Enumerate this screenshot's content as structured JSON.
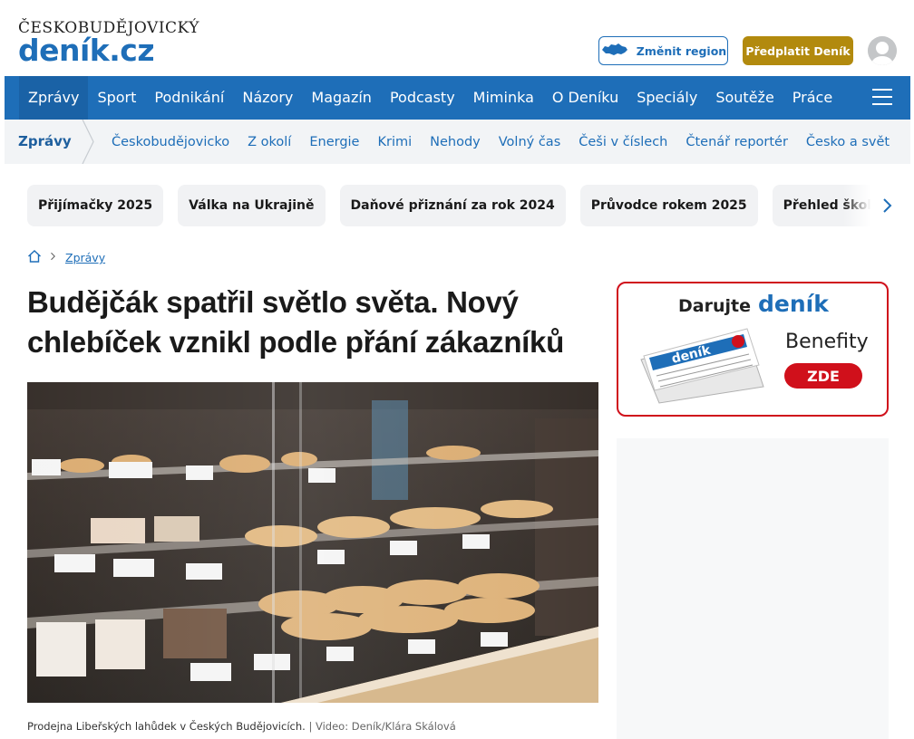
{
  "header": {
    "logo_top": "ČESKOBUDĚJOVICKÝ",
    "logo_main": "deník.cz",
    "change_region_label": "Změnit region",
    "subscribe_label": "Předplatit Deník"
  },
  "main_nav": {
    "items": [
      "Zprávy",
      "Sport",
      "Podnikání",
      "Názory",
      "Magazín",
      "Podcasty",
      "Miminka",
      "O Deníku",
      "Speciály",
      "Soutěže",
      "Práce"
    ],
    "accent": "#1e6eb8"
  },
  "sub_nav": {
    "section": "Zprávy",
    "links": [
      "Českobudějovicko",
      "Z okolí",
      "Energie",
      "Krimi",
      "Nehody",
      "Volný čas",
      "Češi v číslech",
      "Čtenář reportér",
      "Česko a svět"
    ]
  },
  "topics": [
    "Přijímačky 2025",
    "Válka na Ukrajině",
    "Daňové přiznání za rok 2024",
    "Průvodce rokem 2025",
    "Přehled školních prázdnin"
  ],
  "breadcrumb": {
    "current": "Zprávy"
  },
  "article": {
    "title": "Budějčák spatřil světlo světa. Nový chlebíček vznikl podle přání zákazníků",
    "caption": "Prodejna Libeřských lahůdek v Českých Budějovicích.",
    "credit": "| Video: Deník/Klára Skálová"
  },
  "ad": {
    "head_text": "Darujte",
    "head_brand": "deník",
    "benefity": "Benefity",
    "cta": "ZDE",
    "border_color": "#d0101b"
  }
}
